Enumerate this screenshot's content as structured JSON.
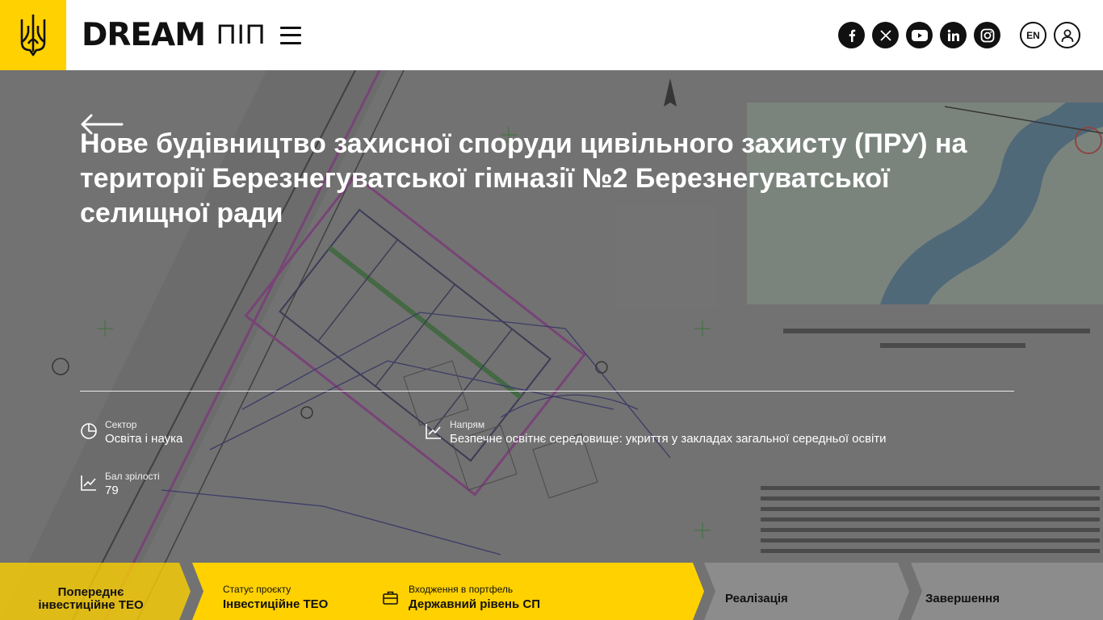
{
  "header": {
    "brand": "DREAM",
    "brand_sub": "ПІП",
    "lang": "EN",
    "socials": [
      "facebook-icon",
      "x-icon",
      "youtube-icon",
      "linkedin-icon",
      "instagram-icon"
    ]
  },
  "project": {
    "title": "Нове будівництво захисної споруди цивільного захисту (ПРУ) на території Березнегуватської гімназії №2 Березнегуватської селищної ради"
  },
  "meta": {
    "sector_label": "Сектор",
    "sector_value": "Освіта і наука",
    "direction_label": "Напрям",
    "direction_value": "Безпечне освітнє середовище: укриття у закладах загальної середньої освіти",
    "maturity_label": "Бал зрілості",
    "maturity_value": "79"
  },
  "stages": {
    "prev": "Попереднє інвестиційне ТЕО",
    "status_label": "Статус проєкту",
    "status_value": "Інвестиційне ТЕО",
    "portfolio_label": "Входження в портфель",
    "portfolio_value": "Державний рівень СП",
    "realization": "Реалізація",
    "completion": "Завершення"
  },
  "colors": {
    "accent_yellow": "#ffd100",
    "header_bg": "#ffffff",
    "text_dark": "#111111"
  }
}
